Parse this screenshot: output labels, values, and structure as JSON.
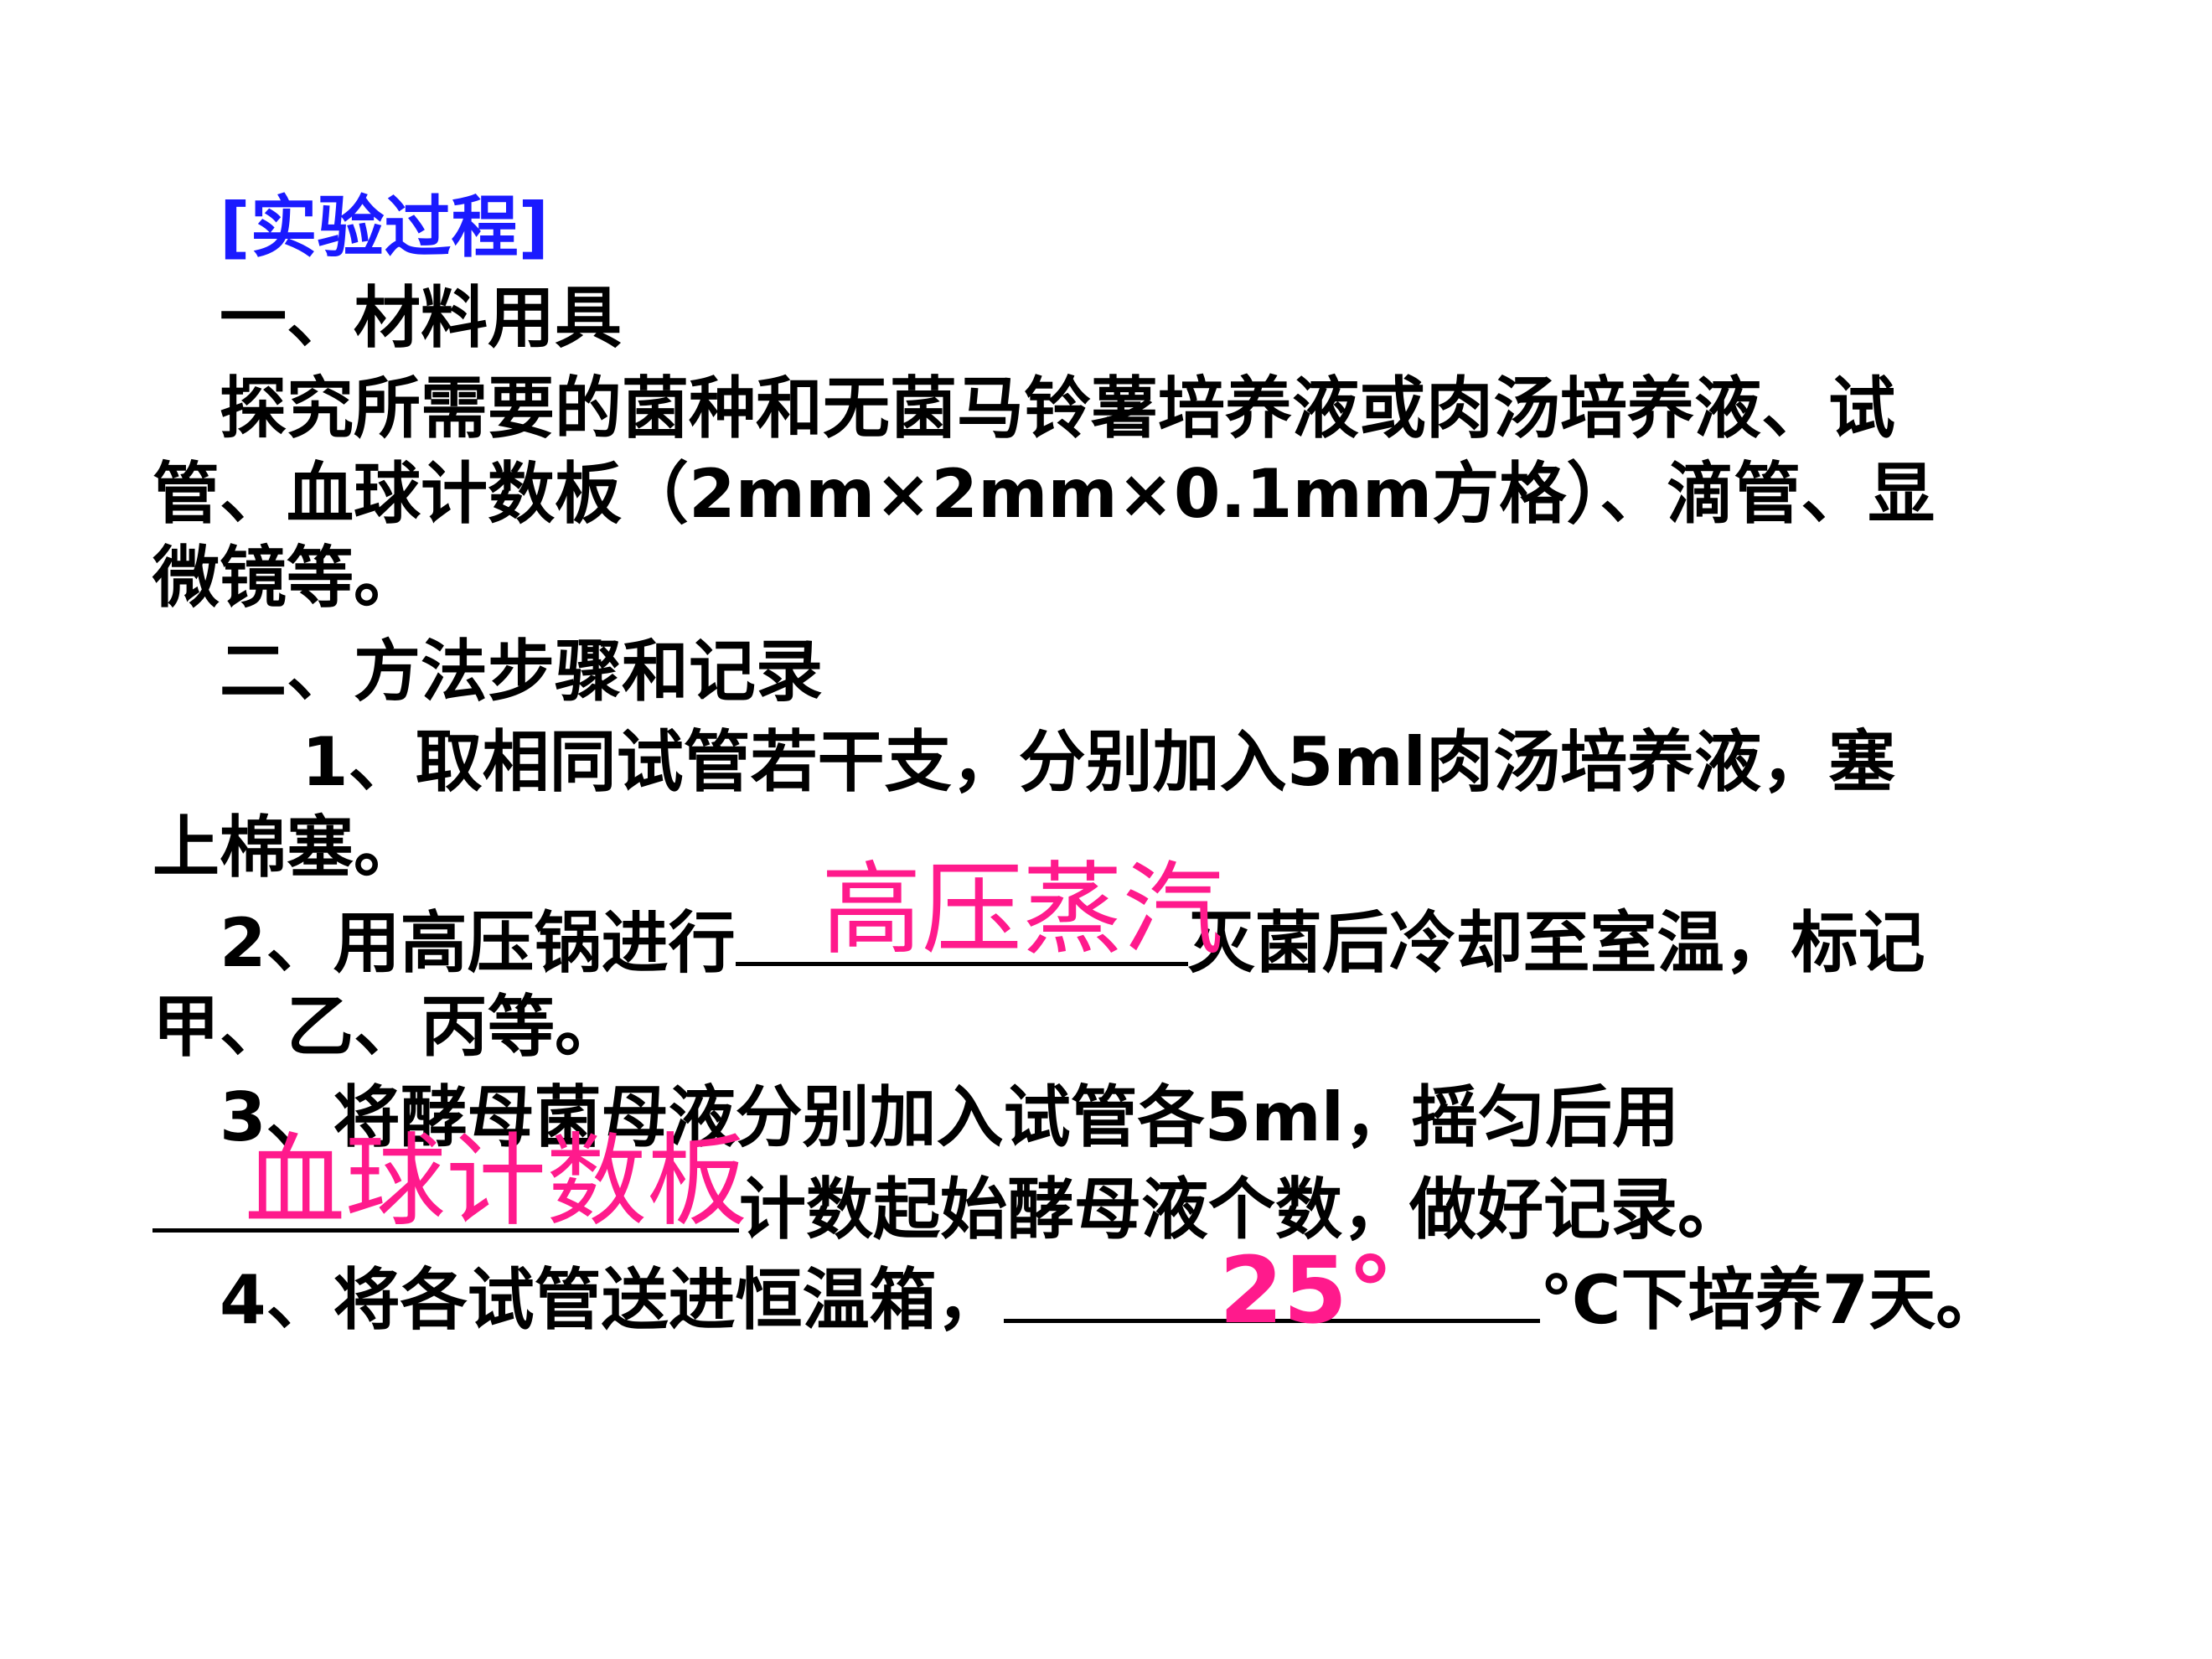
{
  "heading": "[实验过程]",
  "section1": {
    "title": "一、材料用具",
    "text_line1": "探究所需要的菌种和无菌马铃薯培养液或肉汤培养液、试",
    "text_line2": "管、血球计数板（2mm×2mm×0.1mm方格）、滴管、显",
    "text_line3": "微镜等。"
  },
  "section2": {
    "title": "二、方法步骤和记录",
    "step1_line1": "1、取相同试管若干支，分别加入5ml肉汤培养液，塞",
    "step1_line2": "上棉塞。",
    "step2_before": "2、用高压锅进行",
    "step2_answer": "高压蒸汽",
    "step2_after": "灭菌后冷却至室温，标记",
    "step2_line2": "甲、乙、丙等。",
    "step3_line1": "3、将酵母菌母液分别加入试管各5ml，摇匀后用",
    "step3_answer": "血球计数板",
    "step3_after": "计数起始酵母液个数，做好记录。",
    "step4_before": "4、将各试管送进恒温箱，",
    "step4_answer": "25°",
    "step4_after": "℃下培养7天。"
  },
  "colors": {
    "heading": "#1a1aff",
    "answer": "#ff1a8c",
    "text": "#000000",
    "background": "#ffffff"
  }
}
